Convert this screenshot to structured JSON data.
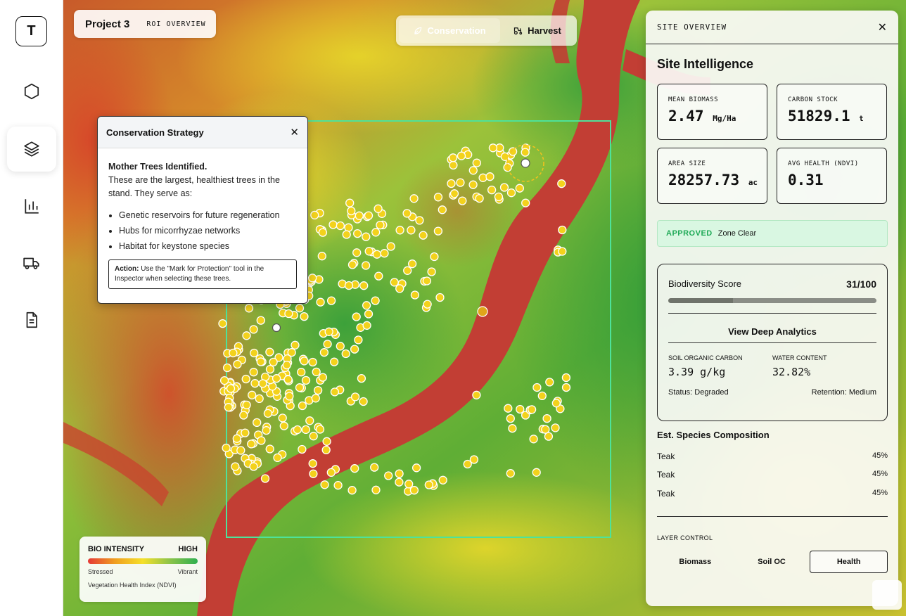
{
  "rail": {
    "logo": "T",
    "items": [
      {
        "icon": "hexagon-icon"
      },
      {
        "icon": "layers-icon",
        "active": true
      },
      {
        "icon": "bar-chart-icon"
      },
      {
        "icon": "truck-icon"
      },
      {
        "icon": "document-icon"
      }
    ]
  },
  "project": {
    "title": "Project 3",
    "subtitle": "ROI OVERVIEW"
  },
  "mode": {
    "conservation": "Conservation",
    "harvest": "Harvest",
    "active": "conservation"
  },
  "strategy": {
    "title": "Conservation Strategy",
    "heading": "Mother Trees Identified.",
    "intro": "These are the largest, healthiest trees in the stand. They serve as:",
    "bullets": [
      "Genetic reservoirs for future regeneration",
      "Hubs for micorrhyzae networks",
      "Habitat for keystone species"
    ],
    "action_label": "Action:",
    "action_text": "Use the \"Mark for Protection\" tool in the Inspector when selecting these trees."
  },
  "legend": {
    "title": "BIO INTENSITY",
    "high": "HIGH",
    "low_label": "Stressed",
    "high_label": "Vibrant",
    "footer": "Vegetation Health Index (NDVI)",
    "colors": [
      "#e53935",
      "#f0a020",
      "#f5e02a",
      "#8bc34a",
      "#2eaf4f"
    ]
  },
  "panel": {
    "header": "SITE OVERVIEW",
    "title": "Site Intelligence",
    "metrics": [
      {
        "label": "MEAN BIOMASS",
        "value": "2.47",
        "unit": "Mg/Ha"
      },
      {
        "label": "CARBON STOCK",
        "value": "51829.1",
        "unit": "t"
      },
      {
        "label": "AREA SIZE",
        "value": "28257.73",
        "unit": "ac"
      },
      {
        "label": "AVG HEALTH (NDVI)",
        "value": "0.31",
        "unit": ""
      }
    ],
    "status": {
      "state": "APPROVED",
      "text": "Zone Clear"
    },
    "biodiversity": {
      "label": "Biodiversity Score",
      "score": "31/100",
      "fraction": 0.31,
      "deep_link": "View Deep Analytics",
      "soil_label": "SOIL ORGANIC CARBON",
      "soil_value": "3.39 g/kg",
      "water_label": "WATER CONTENT",
      "water_value": "32.82%",
      "soil_status": "Status: Degraded",
      "water_status": "Retention: Medium"
    },
    "species_title": "Est. Species Composition",
    "species": [
      {
        "name": "Teak",
        "pct": "45%"
      },
      {
        "name": "Teak",
        "pct": "45%"
      },
      {
        "name": "Teak",
        "pct": "45%"
      }
    ],
    "layer_title": "LAYER CONTROL",
    "layers": [
      {
        "label": "Biomass"
      },
      {
        "label": "Soil OC"
      },
      {
        "label": "Health",
        "active": true
      }
    ]
  }
}
